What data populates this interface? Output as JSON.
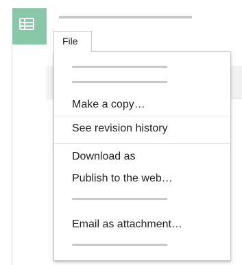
{
  "app": {
    "icon": "spreadsheet-icon",
    "icon_color": "#88c7a7"
  },
  "menubar": {
    "file_label": "File"
  },
  "file_menu": {
    "items": [
      {
        "label": "Make a copy…"
      },
      {
        "label": "See revision history"
      },
      {
        "label": "Download as"
      },
      {
        "label": "Publish to the web…"
      },
      {
        "label": "Email as attachment…"
      }
    ]
  }
}
